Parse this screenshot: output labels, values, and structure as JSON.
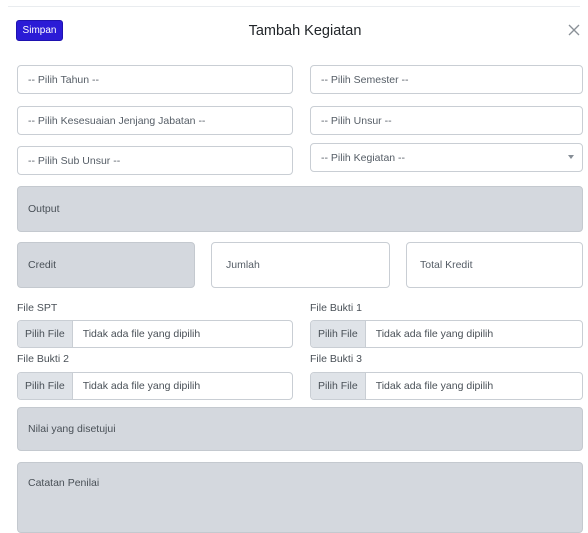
{
  "header": {
    "save_label": "Simpan",
    "title": "Tambah Kegiatan",
    "close_icon": "close-icon"
  },
  "form": {
    "tahun_placeholder": "-- Pilih Tahun --",
    "semester_placeholder": "-- Pilih Semester --",
    "jenjang_placeholder": "-- Pilih Kesesuaian Jenjang Jabatan --",
    "unsur_placeholder": "-- Pilih Unsur --",
    "sub_unsur_placeholder": "-- Pilih Sub Unsur --",
    "kegiatan_placeholder": "-- Pilih Kegiatan --",
    "output_placeholder": "Output",
    "credit_placeholder": "Credit",
    "jumlah_placeholder": "Jumlah",
    "total_kredit_placeholder": "Total Kredit",
    "nilai_placeholder": "Nilai yang disetujui",
    "catatan_placeholder": "Catatan Penilai"
  },
  "files": {
    "button_label": "Pilih File",
    "empty_text": "Tidak ada file yang dipilih",
    "spt_label": "File SPT",
    "bukti1_label": "File Bukti 1",
    "bukti2_label": "File Bukti 2",
    "bukti3_label": "File Bukti 3"
  },
  "colors": {
    "primary": "#2b1bd6",
    "readonly_bg": "#d4d8de",
    "border": "#c9ced4"
  }
}
